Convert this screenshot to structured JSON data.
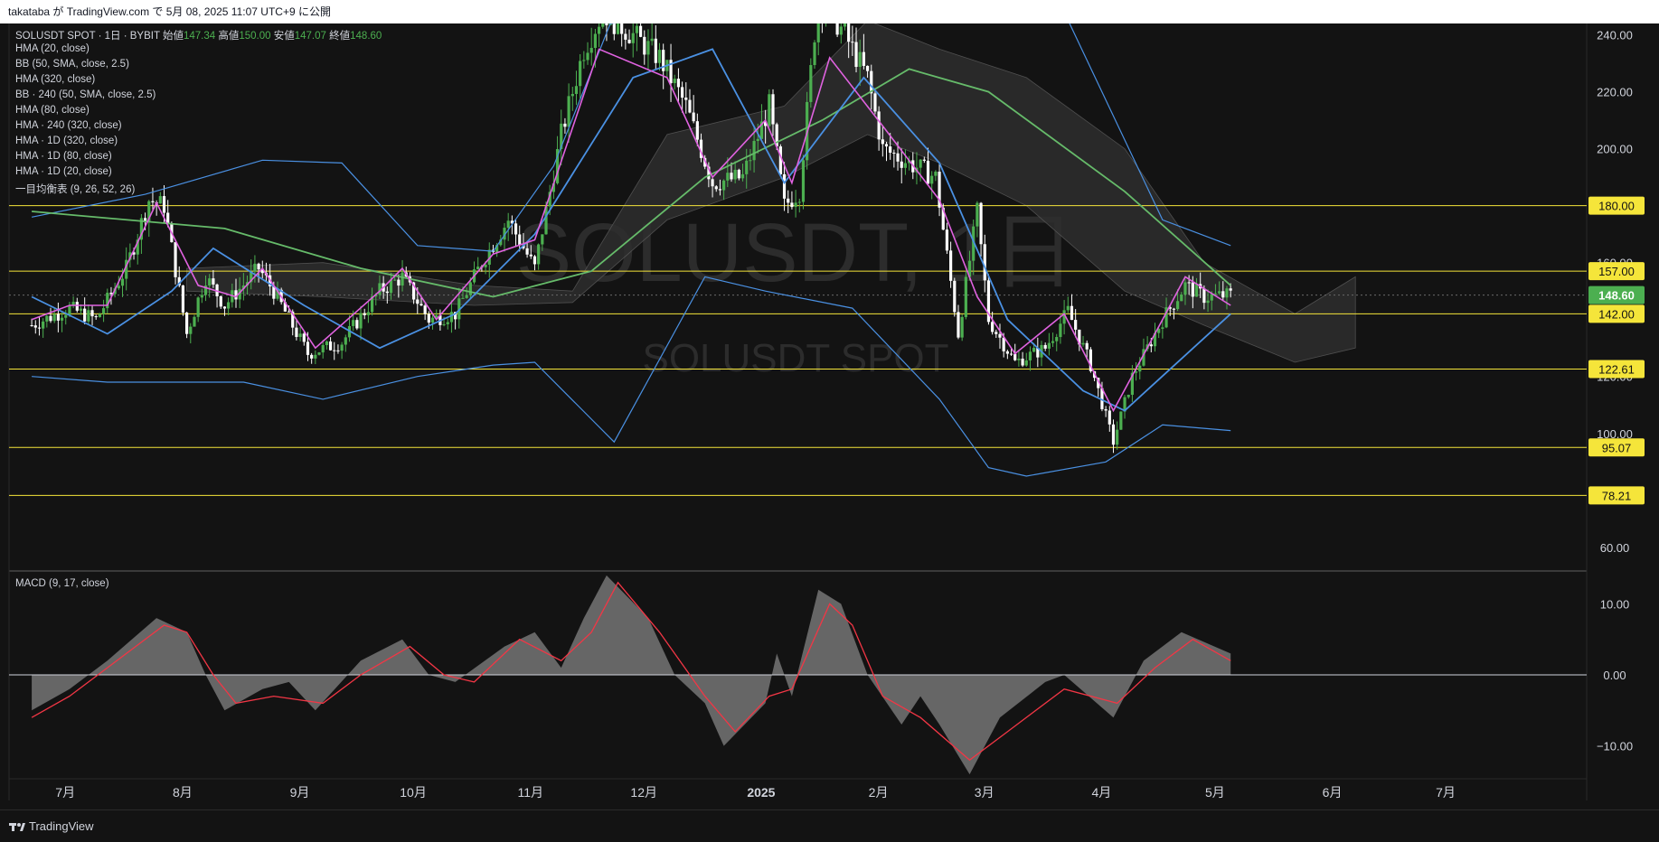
{
  "header": {
    "published_text": "takataba が TradingView.com で 5月 08, 2025 11:07 UTC+9 に公開"
  },
  "legend": {
    "symbol_line": "SOLUSDT SPOT · 1日 · BYBIT",
    "open_label": "始値",
    "open": "147.34",
    "high_label": "高値",
    "high": "150.00",
    "low_label": "安値",
    "low": "147.07",
    "close_label": "終値",
    "close": "148.60",
    "indicators": [
      "HMA (20, close)",
      "BB (50, SMA, close, 2.5)",
      "HMA (320, close)",
      "BB · 240 (50, SMA, close, 2.5)",
      "HMA (80, close)",
      "HMA · 240 (320, close)",
      "HMA · 1D (320, close)",
      "HMA · 1D (80, close)",
      "HMA · 1D (20, close)",
      "一目均衡表 (9, 26, 52, 26)"
    ],
    "macd_label": "MACD (9, 17, close)"
  },
  "watermark": {
    "title": "SOLUSDT, 1日",
    "subtitle": "SOLUSDT SPOT"
  },
  "footer": {
    "brand": "TradingView"
  },
  "colors": {
    "background": "#131313",
    "up": "#4caf50",
    "down": "#ffffff",
    "level_line": "#f5e53a",
    "level_tag_bg": "#f5e53a",
    "price_tag_bg": "#4caf50",
    "bb_line": "#4a90e2",
    "hma20": "#e062e0",
    "hma80": "#4a90e2",
    "hma320": "#66bb6a",
    "macd_hist": "#707070",
    "macd_signal": "#f23645"
  },
  "chart_data": [
    {
      "type": "candlestick",
      "title": "SOLUSDT, 1日",
      "ylim": [
        52,
        244
      ],
      "y_ticks": [
        60,
        100,
        120,
        160,
        200,
        220,
        240
      ],
      "y_tick_labels": [
        "60.00",
        "100.00",
        "120.00",
        "160.00",
        "200.00",
        "220.00",
        "240.00"
      ],
      "x_ticks": [
        "7月",
        "8月",
        "9月",
        "10月",
        "11月",
        "12月",
        "2025",
        "2月",
        "3月",
        "4月",
        "5月",
        "6月",
        "7月"
      ],
      "last_price": 148.6,
      "last_price_label": "148.60",
      "levels": [
        {
          "value": 180.0,
          "label": "180.00"
        },
        {
          "value": 157.0,
          "label": "157.00"
        },
        {
          "value": 142.0,
          "label": "142.00"
        },
        {
          "value": 122.61,
          "label": "122.61"
        },
        {
          "value": 95.07,
          "label": "95.07"
        },
        {
          "value": 78.21,
          "label": "78.21"
        }
      ],
      "close_path": [
        [
          "2024-06-25",
          138
        ],
        [
          "2024-07-05",
          144
        ],
        [
          "2024-07-12",
          140
        ],
        [
          "2024-07-20",
          158
        ],
        [
          "2024-07-26",
          182
        ],
        [
          "2024-07-30",
          180
        ],
        [
          "2024-08-05",
          135
        ],
        [
          "2024-08-10",
          155
        ],
        [
          "2024-08-15",
          145
        ],
        [
          "2024-08-24",
          158
        ],
        [
          "2024-08-28",
          150
        ],
        [
          "2024-09-06",
          128
        ],
        [
          "2024-09-15",
          132
        ],
        [
          "2024-09-25",
          150
        ],
        [
          "2024-10-01",
          155
        ],
        [
          "2024-10-08",
          140
        ],
        [
          "2024-10-15",
          142
        ],
        [
          "2024-10-22",
          160
        ],
        [
          "2024-10-29",
          175
        ],
        [
          "2024-11-05",
          158
        ],
        [
          "2024-11-12",
          205
        ],
        [
          "2024-11-18",
          235
        ],
        [
          "2024-11-23",
          248
        ],
        [
          "2024-12-01",
          240
        ],
        [
          "2024-12-08",
          232
        ],
        [
          "2024-12-15",
          215
        ],
        [
          "2024-12-22",
          188
        ],
        [
          "2024-12-30",
          190
        ],
        [
          "2025-01-06",
          215
        ],
        [
          "2025-01-10",
          180
        ],
        [
          "2025-01-14",
          185
        ],
        [
          "2025-01-19",
          255
        ],
        [
          "2025-01-26",
          240
        ],
        [
          "2025-02-01",
          225
        ],
        [
          "2025-02-05",
          200
        ],
        [
          "2025-02-12",
          195
        ],
        [
          "2025-02-19",
          190
        ],
        [
          "2025-02-25",
          135
        ],
        [
          "2025-03-02",
          178
        ],
        [
          "2025-03-05",
          140
        ],
        [
          "2025-03-12",
          125
        ],
        [
          "2025-03-20",
          130
        ],
        [
          "2025-03-26",
          143
        ],
        [
          "2025-04-01",
          124
        ],
        [
          "2025-04-07",
          97
        ],
        [
          "2025-04-12",
          120
        ],
        [
          "2025-04-20",
          140
        ],
        [
          "2025-04-26",
          152
        ],
        [
          "2025-05-01",
          148
        ],
        [
          "2025-05-08",
          148.6
        ]
      ],
      "indicators": {
        "hma20": [
          [
            "2024-06-25",
            140
          ],
          [
            "2024-07-05",
            145
          ],
          [
            "2024-07-15",
            145
          ],
          [
            "2024-07-28",
            181
          ],
          [
            "2024-08-08",
            152
          ],
          [
            "2024-08-18",
            148
          ],
          [
            "2024-08-25",
            158
          ],
          [
            "2024-09-08",
            130
          ],
          [
            "2024-09-25",
            150
          ],
          [
            "2024-10-01",
            158
          ],
          [
            "2024-10-10",
            140
          ],
          [
            "2024-10-25",
            163
          ],
          [
            "2024-11-05",
            168
          ],
          [
            "2024-11-22",
            235
          ],
          [
            "2024-12-10",
            225
          ],
          [
            "2024-12-22",
            190
          ],
          [
            "2025-01-05",
            210
          ],
          [
            "2025-01-12",
            188
          ],
          [
            "2025-01-22",
            232
          ],
          [
            "2025-02-05",
            208
          ],
          [
            "2025-02-20",
            182
          ],
          [
            "2025-03-02",
            148
          ],
          [
            "2025-03-12",
            128
          ],
          [
            "2025-03-25",
            142
          ],
          [
            "2025-04-07",
            108
          ],
          [
            "2025-04-20",
            140
          ],
          [
            "2025-04-26",
            155
          ],
          [
            "2025-05-08",
            145
          ]
        ],
        "hma80": [
          [
            "2024-06-25",
            148
          ],
          [
            "2024-07-15",
            135
          ],
          [
            "2024-08-01",
            150
          ],
          [
            "2024-08-12",
            165
          ],
          [
            "2024-09-05",
            145
          ],
          [
            "2024-09-25",
            130
          ],
          [
            "2024-10-15",
            142
          ],
          [
            "2024-11-05",
            170
          ],
          [
            "2024-12-01",
            225
          ],
          [
            "2024-12-22",
            235
          ],
          [
            "2025-01-10",
            188
          ],
          [
            "2025-01-31",
            225
          ],
          [
            "2025-02-20",
            195
          ],
          [
            "2025-03-10",
            140
          ],
          [
            "2025-03-30",
            115
          ],
          [
            "2025-04-10",
            108
          ],
          [
            "2025-05-08",
            142
          ]
        ],
        "hma320": [
          [
            "2024-06-25",
            178
          ],
          [
            "2024-08-15",
            172
          ],
          [
            "2024-09-20",
            158
          ],
          [
            "2024-10-25",
            148
          ],
          [
            "2024-11-20",
            157
          ],
          [
            "2024-12-20",
            190
          ],
          [
            "2025-01-20",
            210
          ],
          [
            "2025-02-12",
            228
          ],
          [
            "2025-03-05",
            220
          ],
          [
            "2025-04-10",
            185
          ],
          [
            "2025-05-08",
            152
          ]
        ],
        "bb_upper": [
          [
            "2024-06-25",
            176
          ],
          [
            "2024-07-25",
            184
          ],
          [
            "2024-08-25",
            196
          ],
          [
            "2024-09-15",
            195
          ],
          [
            "2024-10-05",
            166
          ],
          [
            "2024-10-25",
            164
          ],
          [
            "2024-11-10",
            194
          ],
          [
            "2024-11-25",
            244
          ],
          [
            "2025-01-10",
            250
          ],
          [
            "2025-02-10",
            248
          ],
          [
            "2025-03-05",
            246
          ],
          [
            "2025-03-25",
            248
          ],
          [
            "2025-04-20",
            175
          ],
          [
            "2025-05-08",
            166
          ]
        ],
        "bb_lower": [
          [
            "2024-06-25",
            120
          ],
          [
            "2024-07-15",
            118
          ],
          [
            "2024-08-20",
            118
          ],
          [
            "2024-09-10",
            112
          ],
          [
            "2024-10-05",
            120
          ],
          [
            "2024-10-25",
            124
          ],
          [
            "2024-11-05",
            125
          ],
          [
            "2024-11-20",
            105
          ],
          [
            "2024-11-26",
            97
          ],
          [
            "2024-12-20",
            155
          ],
          [
            "2025-01-05",
            150
          ],
          [
            "2025-01-28",
            144
          ],
          [
            "2025-02-20",
            112
          ],
          [
            "2025-03-05",
            88
          ],
          [
            "2025-03-15",
            85
          ],
          [
            "2025-04-05",
            90
          ],
          [
            "2025-04-20",
            103
          ],
          [
            "2025-05-08",
            101
          ]
        ]
      }
    },
    {
      "type": "area",
      "title": "MACD (9, 17, close)",
      "ylim": [
        -14.5,
        14.5
      ],
      "y_ticks": [
        10,
        0,
        -10
      ],
      "y_tick_labels": [
        "10.00",
        "0.00",
        "−10.00"
      ],
      "histogram": [
        [
          "2024-06-25",
          -5
        ],
        [
          "2024-07-05",
          -2
        ],
        [
          "2024-07-15",
          2
        ],
        [
          "2024-07-28",
          8
        ],
        [
          "2024-08-05",
          6
        ],
        [
          "2024-08-10",
          0
        ],
        [
          "2024-08-15",
          -5
        ],
        [
          "2024-08-25",
          -2
        ],
        [
          "2024-09-01",
          -1
        ],
        [
          "2024-09-08",
          -5
        ],
        [
          "2024-09-20",
          2
        ],
        [
          "2024-10-01",
          5
        ],
        [
          "2024-10-08",
          0
        ],
        [
          "2024-10-15",
          -1
        ],
        [
          "2024-10-28",
          4
        ],
        [
          "2024-11-05",
          6
        ],
        [
          "2024-11-12",
          1
        ],
        [
          "2024-11-18",
          8
        ],
        [
          "2024-11-24",
          14
        ],
        [
          "2024-12-05",
          8
        ],
        [
          "2024-12-12",
          0
        ],
        [
          "2024-12-20",
          -4
        ],
        [
          "2024-12-25",
          -10
        ],
        [
          "2025-01-05",
          -4
        ],
        [
          "2025-01-08",
          3
        ],
        [
          "2025-01-12",
          -3
        ],
        [
          "2025-01-19",
          12
        ],
        [
          "2025-01-25",
          10
        ],
        [
          "2025-02-01",
          0
        ],
        [
          "2025-02-10",
          -7
        ],
        [
          "2025-02-15",
          -3
        ],
        [
          "2025-02-20",
          -7
        ],
        [
          "2025-02-28",
          -14
        ],
        [
          "2025-03-08",
          -6
        ],
        [
          "2025-03-20",
          -1
        ],
        [
          "2025-03-25",
          0
        ],
        [
          "2025-04-07",
          -6
        ],
        [
          "2025-04-15",
          2
        ],
        [
          "2025-04-25",
          6
        ],
        [
          "2025-05-08",
          3
        ]
      ],
      "signal": [
        [
          "2024-06-25",
          -6
        ],
        [
          "2024-07-05",
          -3
        ],
        [
          "2024-07-15",
          1
        ],
        [
          "2024-07-30",
          7
        ],
        [
          "2024-08-05",
          6
        ],
        [
          "2024-08-12",
          0
        ],
        [
          "2024-08-18",
          -4
        ],
        [
          "2024-08-28",
          -3
        ],
        [
          "2024-09-10",
          -4
        ],
        [
          "2024-09-20",
          0
        ],
        [
          "2024-10-03",
          4
        ],
        [
          "2024-10-12",
          0
        ],
        [
          "2024-10-20",
          -1
        ],
        [
          "2024-11-01",
          5
        ],
        [
          "2024-11-12",
          2
        ],
        [
          "2024-11-20",
          6
        ],
        [
          "2024-11-27",
          13
        ],
        [
          "2024-12-08",
          6
        ],
        [
          "2024-12-20",
          -3
        ],
        [
          "2024-12-28",
          -8
        ],
        [
          "2025-01-06",
          -3
        ],
        [
          "2025-01-12",
          -2
        ],
        [
          "2025-01-22",
          10
        ],
        [
          "2025-01-28",
          7
        ],
        [
          "2025-02-05",
          -3
        ],
        [
          "2025-02-15",
          -6
        ],
        [
          "2025-02-28",
          -12
        ],
        [
          "2025-03-10",
          -8
        ],
        [
          "2025-03-25",
          -2
        ],
        [
          "2025-04-08",
          -4
        ],
        [
          "2025-04-18",
          1
        ],
        [
          "2025-04-28",
          5
        ],
        [
          "2025-05-08",
          2
        ]
      ]
    }
  ]
}
